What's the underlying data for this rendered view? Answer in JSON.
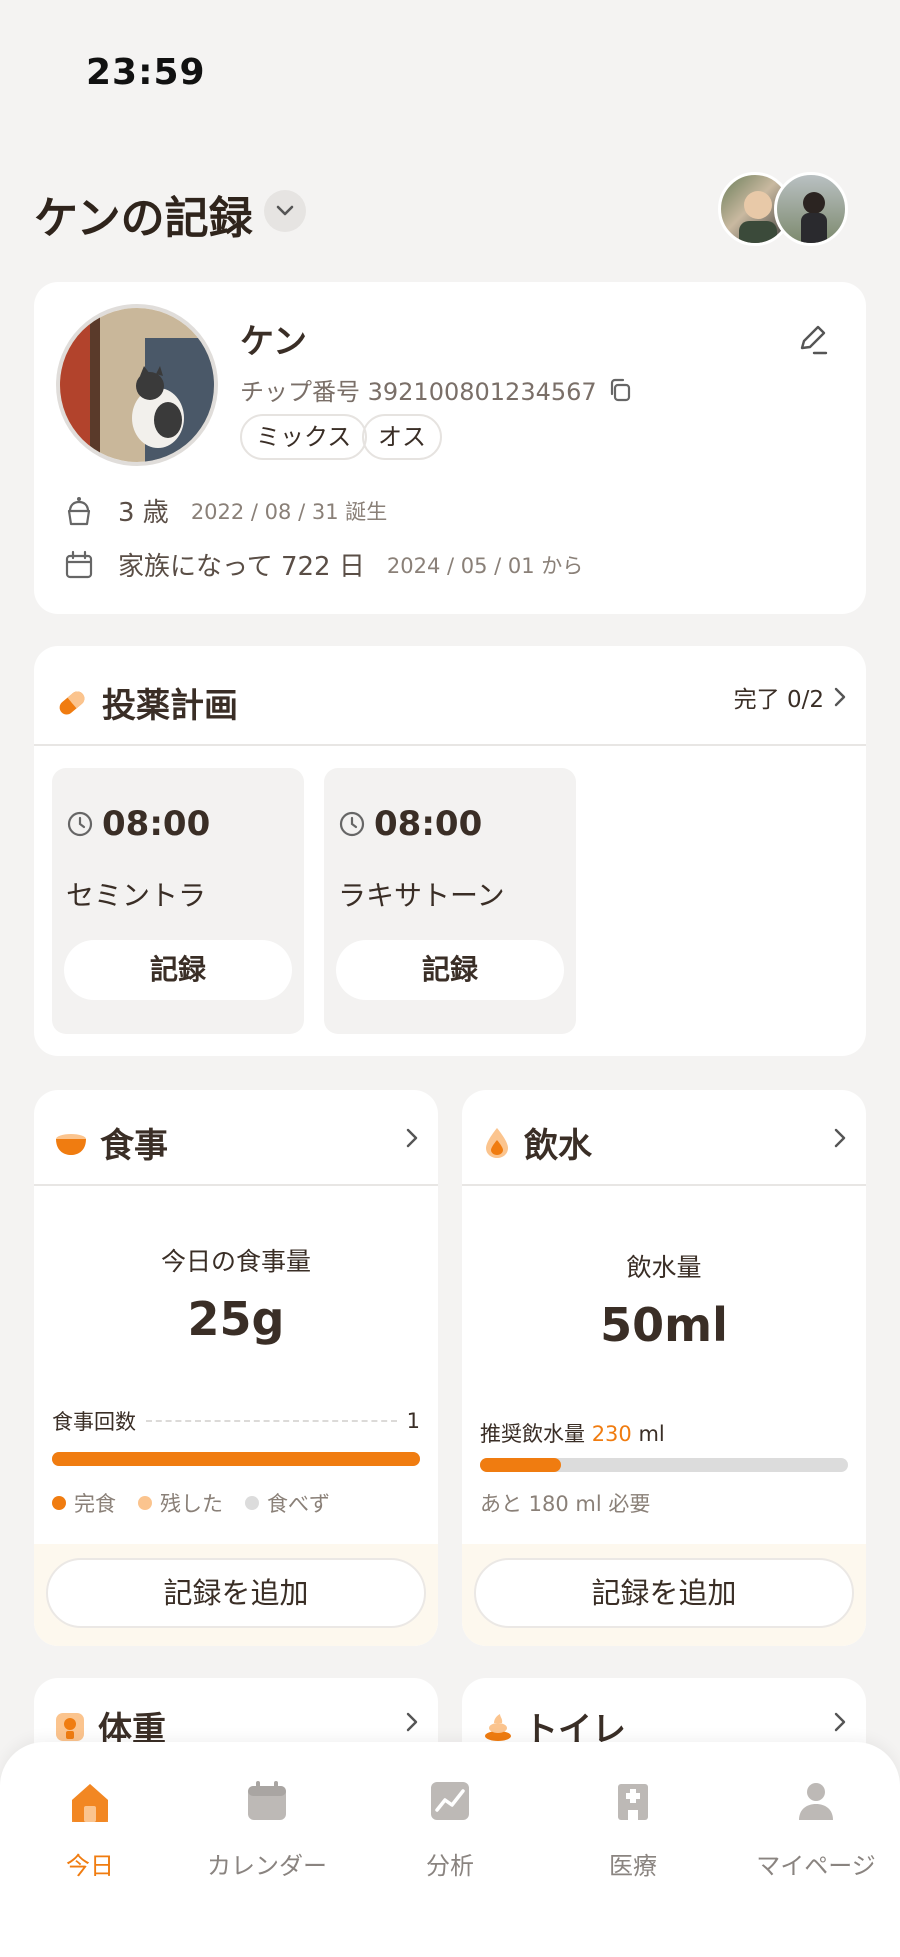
{
  "status_bar": {
    "time": "23:59"
  },
  "header": {
    "title": "ケンの記録"
  },
  "pet": {
    "name": "ケン",
    "chip_label": "チップ番号 392100801234567",
    "tags": [
      "ミックス",
      "オス"
    ],
    "age": "3 歳",
    "birthday": "2022 / 08 / 31 誕生",
    "family_days": "家族になって 722 日",
    "family_since": "2024 / 05 / 01 から"
  },
  "medication": {
    "title": "投薬計画",
    "status": "完了 0/2",
    "items": [
      {
        "time": "08:00",
        "name": "セミントラ",
        "button": "記録"
      },
      {
        "time": "08:00",
        "name": "ラキサトーン",
        "button": "記録"
      }
    ]
  },
  "meal": {
    "title": "食事",
    "label": "今日の食事量",
    "value": "25g",
    "count_label": "食事回数",
    "count": "1",
    "progress": 1.0,
    "legend": [
      "完食",
      "残した",
      "食べず"
    ],
    "add_button": "記録を追加"
  },
  "water": {
    "title": "飲水",
    "label": "飲水量",
    "value": "50ml",
    "recommend_prefix": "推奨飲水量",
    "recommend_value": "230",
    "recommend_unit": "ml",
    "progress": 0.22,
    "remaining": "あと 180 ml 必要",
    "add_button": "記録を追加"
  },
  "peek_cards": {
    "weight": "体重",
    "toilet": "トイレ"
  },
  "tabbar": {
    "items": [
      {
        "label": "今日",
        "icon": "home-icon",
        "active": true
      },
      {
        "label": "カレンダー",
        "icon": "calendar-icon",
        "active": false
      },
      {
        "label": "分析",
        "icon": "chart-icon",
        "active": false
      },
      {
        "label": "医療",
        "icon": "hospital-icon",
        "active": false
      },
      {
        "label": "マイページ",
        "icon": "person-icon",
        "active": false
      }
    ]
  },
  "colors": {
    "accent": "#f07c10",
    "background": "#f4f3f2",
    "card": "#ffffff",
    "text": "#3a2e26"
  }
}
